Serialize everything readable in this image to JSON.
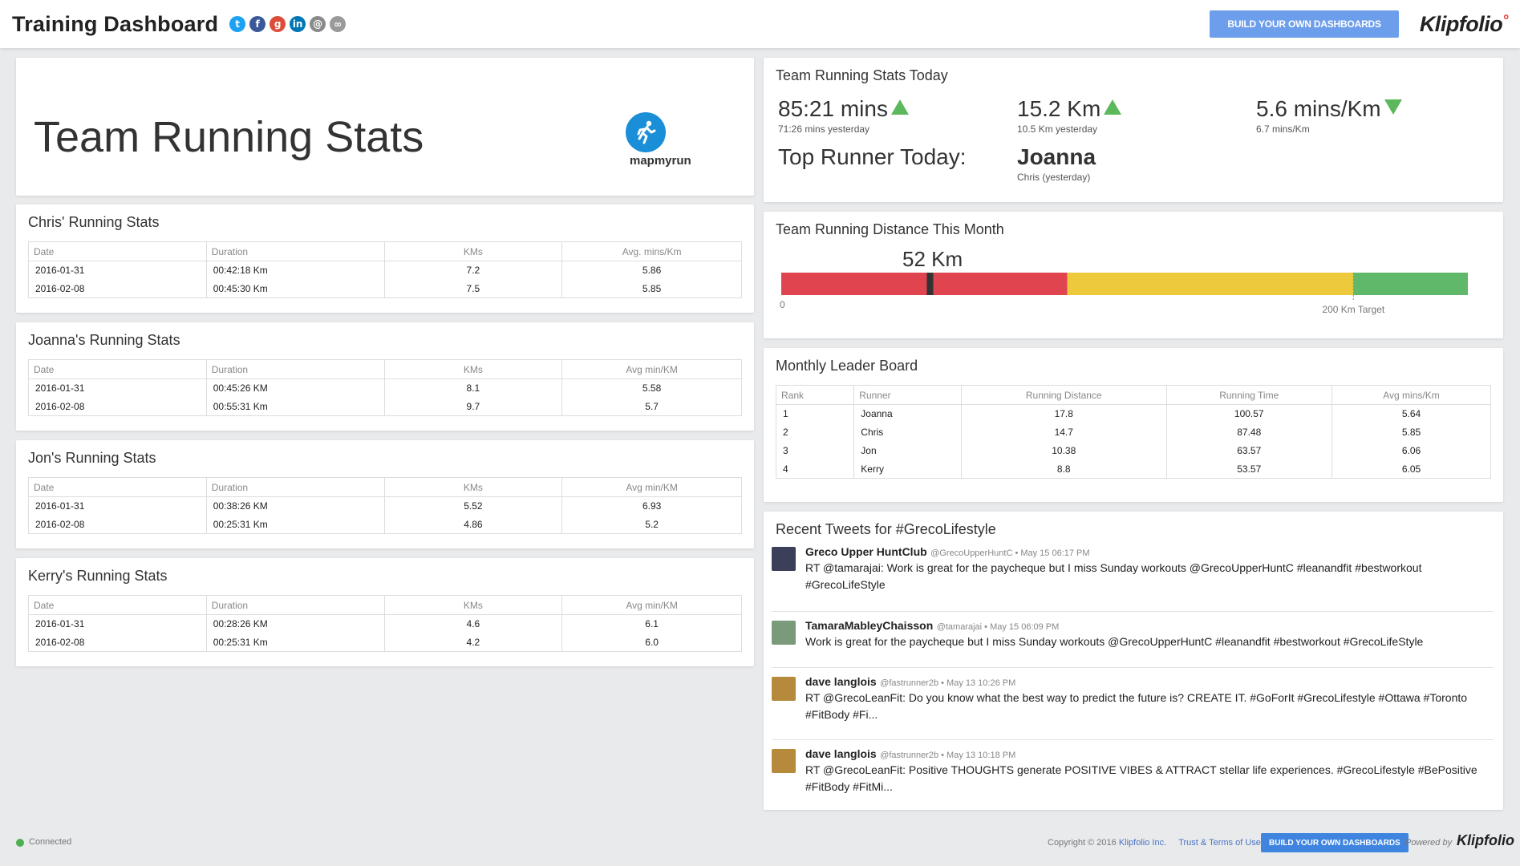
{
  "header": {
    "title": "Training Dashboard",
    "social": [
      {
        "icon": "twitter-icon",
        "glyph": "t",
        "color": "#1da1f2"
      },
      {
        "icon": "facebook-icon",
        "glyph": "f",
        "color": "#3b5998"
      },
      {
        "icon": "google-plus-icon",
        "glyph": "g",
        "color": "#dd4b39"
      },
      {
        "icon": "linkedin-icon",
        "glyph": "in",
        "color": "#0077b5"
      },
      {
        "icon": "email-icon",
        "glyph": "@",
        "color": "#8a8a8a"
      },
      {
        "icon": "link-icon",
        "glyph": "∞",
        "color": "#9a9a9a"
      }
    ],
    "build_button": "BUILD YOUR OWN DASHBOARDS",
    "brand": "Klipfolio"
  },
  "hero": {
    "title": "Team Running Stats",
    "logo_text": "mapmyrun"
  },
  "individual_tables": [
    {
      "title": "Chris' Running Stats",
      "columns": [
        "Date",
        "Duration",
        "KMs",
        "Avg. mins/Km"
      ],
      "rows": [
        [
          "2016-01-31",
          "00:42:18 Km",
          "7.2",
          "5.86"
        ],
        [
          "2016-02-08",
          "00:45:30 Km",
          "7.5",
          "5.85"
        ]
      ]
    },
    {
      "title": "Joanna's Running Stats",
      "columns": [
        "Date",
        "Duration",
        "KMs",
        "Avg min/KM"
      ],
      "rows": [
        [
          "2016-01-31",
          "00:45:26 KM",
          "8.1",
          "5.58"
        ],
        [
          "2016-02-08",
          "00:55:31 Km",
          "9.7",
          "5.7"
        ]
      ]
    },
    {
      "title": "Jon's Running Stats",
      "columns": [
        "Date",
        "Duration",
        "KMs",
        "Avg min/KM"
      ],
      "rows": [
        [
          "2016-01-31",
          "00:38:26 KM",
          "5.52",
          "6.93"
        ],
        [
          "2016-02-08",
          "00:25:31 Km",
          "4.86",
          "5.2"
        ]
      ]
    },
    {
      "title": "Kerry's Running Stats",
      "columns": [
        "Date",
        "Duration",
        "KMs",
        "Avg min/KM"
      ],
      "rows": [
        [
          "2016-01-31",
          "00:28:26 KM",
          "4.6",
          "6.1"
        ],
        [
          "2016-02-08",
          "00:25:31 Km",
          "4.2",
          "6.0"
        ]
      ]
    }
  ],
  "today": {
    "title": "Team Running Stats Today",
    "kpis": [
      {
        "value": "85:21 mins",
        "trend": "up",
        "sub": "71:26 mins yesterday"
      },
      {
        "value": "15.2 Km",
        "trend": "up",
        "sub": "10.5 Km yesterday"
      },
      {
        "value": "5.6 mins/Km",
        "trend": "down",
        "sub": "6.7 mins/Km"
      }
    ],
    "top_runner_label": "Top Runner Today:",
    "top_runner_name": "Joanna",
    "top_runner_sub": "Chris (yesterday)"
  },
  "distance_month": {
    "title": "Team Running Distance This Month",
    "value_label": "52 Km",
    "value": 52,
    "min_label": "0",
    "target_label": "200 Km Target",
    "target": 200,
    "max": 240,
    "bands": [
      {
        "from": 0,
        "to": 100,
        "color": "#e0444f"
      },
      {
        "from": 100,
        "to": 200,
        "color": "#ecca3c"
      },
      {
        "from": 200,
        "to": 240,
        "color": "#60b96a"
      }
    ]
  },
  "leaderboard": {
    "title": "Monthly Leader Board",
    "columns": [
      "Rank",
      "Runner",
      "Running Distance",
      "Running Time",
      "Avg mins/Km"
    ],
    "rows": [
      [
        "1",
        "Joanna",
        "17.8",
        "100.57",
        "5.64"
      ],
      [
        "2",
        "Chris",
        "14.7",
        "87.48",
        "5.85"
      ],
      [
        "3",
        "Jon",
        "10.38",
        "63.57",
        "6.06"
      ],
      [
        "4",
        "Kerry",
        "8.8",
        "53.57",
        "6.05"
      ]
    ]
  },
  "tweets": {
    "title": "Recent Tweets for #GrecoLifestyle",
    "items": [
      {
        "name": "Greco Upper HuntClub",
        "meta": "@GrecoUpperHuntC • May 15 06:17 PM",
        "text": "RT @tamarajai: Work is great for the paycheque but I miss Sunday workouts @GrecoUpperHuntC #leanandfit #bestworkout #GrecoLifeStyle",
        "avatar_color": "#3b3f5a"
      },
      {
        "name": "TamaraMableyChaisson",
        "meta": "@tamarajai • May 15 06:09 PM",
        "text": "Work is great for the paycheque but I miss Sunday workouts @GrecoUpperHuntC #leanandfit #bestworkout #GrecoLifeStyle",
        "avatar_color": "#7a9a7a"
      },
      {
        "name": "dave langlois",
        "meta": "@fastrunner2b • May 13 10:26 PM",
        "text": "RT @GrecoLeanFit: Do you know what the best way to predict the future is? CREATE IT. #GoForIt #GrecoLifestyle #Ottawa #Toronto #FitBody #Fi...",
        "avatar_color": "#b58a3a"
      },
      {
        "name": "dave langlois",
        "meta": "@fastrunner2b • May 13 10:18 PM",
        "text": "RT @GrecoLeanFit: Positive THOUGHTS generate POSITIVE VIBES & ATTRACT stellar life experiences. #GrecoLifestyle #BePositive #FitBody #FitMi...",
        "avatar_color": "#b58a3a"
      }
    ]
  },
  "footer": {
    "status": "Connected",
    "copyright": "Copyright © 2016",
    "company": "Klipfolio Inc.",
    "terms": "Trust & Terms of Use",
    "build_button": "BUILD YOUR OWN DASHBOARDS",
    "powered_by": "Powered by",
    "brand": "Klipfolio"
  }
}
